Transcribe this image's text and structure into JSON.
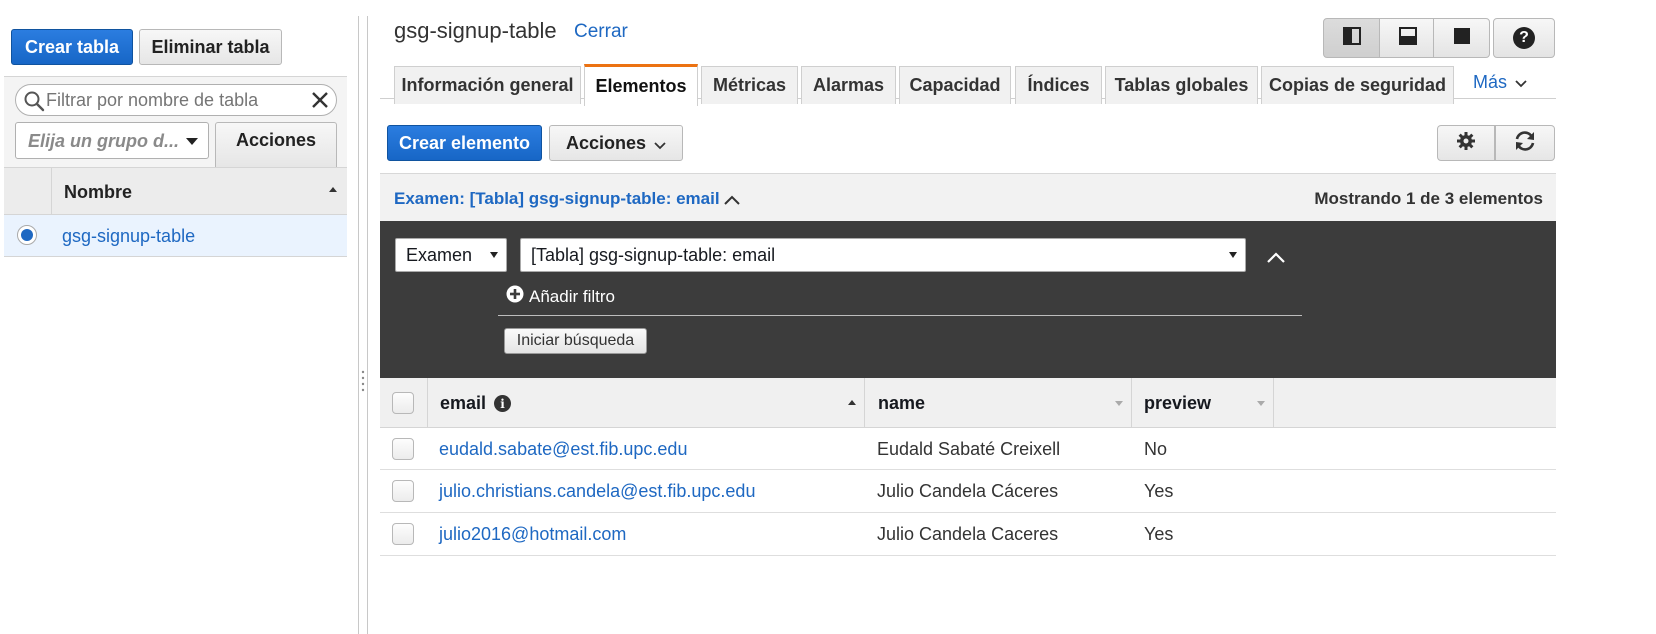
{
  "sidebar": {
    "create_table_label": "Crear tabla",
    "delete_table_label": "Eliminar tabla",
    "filter_placeholder": "Filtrar por nombre de tabla",
    "group_placeholder": "Elija un grupo d...",
    "actions_label": "Acciones",
    "column_header": "Nombre",
    "tables": [
      "gsg-signup-table"
    ]
  },
  "header": {
    "table_name": "gsg-signup-table",
    "close_label": "Cerrar",
    "help_glyph": "?"
  },
  "tabs": [
    {
      "label": "Información general",
      "active": false
    },
    {
      "label": "Elementos",
      "active": true
    },
    {
      "label": "Métricas",
      "active": false
    },
    {
      "label": "Alarmas",
      "active": false
    },
    {
      "label": "Capacidad",
      "active": false
    },
    {
      "label": "Índices",
      "active": false
    },
    {
      "label": "Tablas globales",
      "active": false
    },
    {
      "label": "Copias de seguridad",
      "active": false
    }
  ],
  "more_label": "Más",
  "toolbar": {
    "create_item_label": "Crear elemento",
    "actions_label": "Acciones"
  },
  "scan": {
    "title": "Examen: [Tabla] gsg-signup-table: email",
    "showing": "Mostrando 1 de 3 elementos",
    "mode_value": "Examen",
    "target_value": "[Tabla] gsg-signup-table: email",
    "add_filter_label": "Añadir filtro",
    "start_search_label": "Iniciar búsqueda"
  },
  "table": {
    "columns": [
      "email",
      "name",
      "preview"
    ],
    "rows": [
      {
        "email": "eudald.sabate@est.fib.upc.edu",
        "name": "Eudald Sabaté Creixell",
        "preview": "No"
      },
      {
        "email": "julio.christians.candela@est.fib.upc.edu",
        "name": "Julio Candela Cáceres",
        "preview": "Yes"
      },
      {
        "email": "julio2016@hotmail.com",
        "name": "Julio Candela Caceres",
        "preview": "Yes"
      }
    ]
  },
  "colors": {
    "primary": "#1f6fd3",
    "link": "#1e68c2",
    "active_tab_accent": "#ec7211",
    "filter_panel_bg": "#3c3c3c",
    "selected_row_bg": "#eaf3fe"
  }
}
